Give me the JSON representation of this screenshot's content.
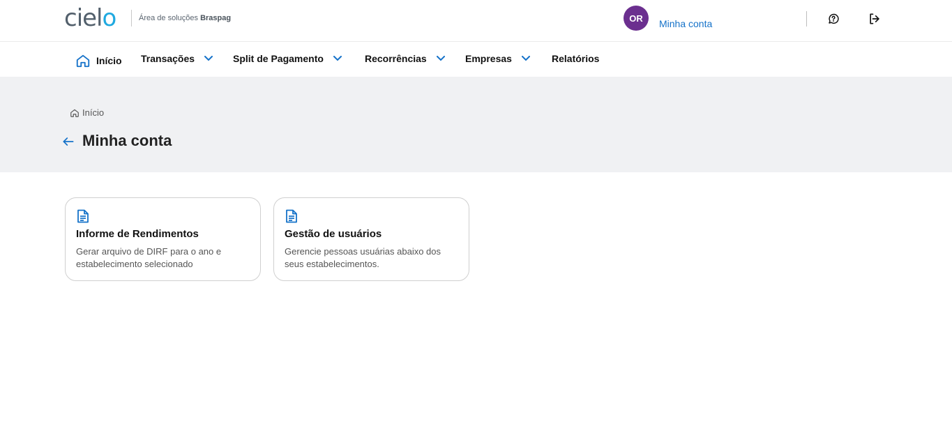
{
  "header": {
    "logo_text_start": "ciel",
    "logo_text_end": "o",
    "logo_subtitle_prefix": "Área de soluções ",
    "logo_subtitle_brand": "Braspag",
    "avatar_initials": "OR",
    "account_label": "Minha conta"
  },
  "nav": {
    "items": [
      {
        "label": "Início"
      },
      {
        "label": "Transações"
      },
      {
        "label": "Split de Pagamento"
      },
      {
        "label": "Recorrências"
      },
      {
        "label": "Empresas"
      },
      {
        "label": "Relatórios"
      }
    ]
  },
  "breadcrumb": {
    "label": "Início"
  },
  "page": {
    "title": "Minha conta"
  },
  "cards": [
    {
      "title": "Informe de Rendimentos",
      "description": "Gerar arquivo de DIRF para o ano e estabelecimento selecionado"
    },
    {
      "title": "Gestão de usuários",
      "description": "Gerencie pessoas usuárias abaixo dos seus estabelecimentos."
    }
  ],
  "colors": {
    "accent": "#1572c9",
    "avatar": "#6b2f8f",
    "hero_bg": "#f0f1f3",
    "logo_o": "#1fa9e0"
  }
}
